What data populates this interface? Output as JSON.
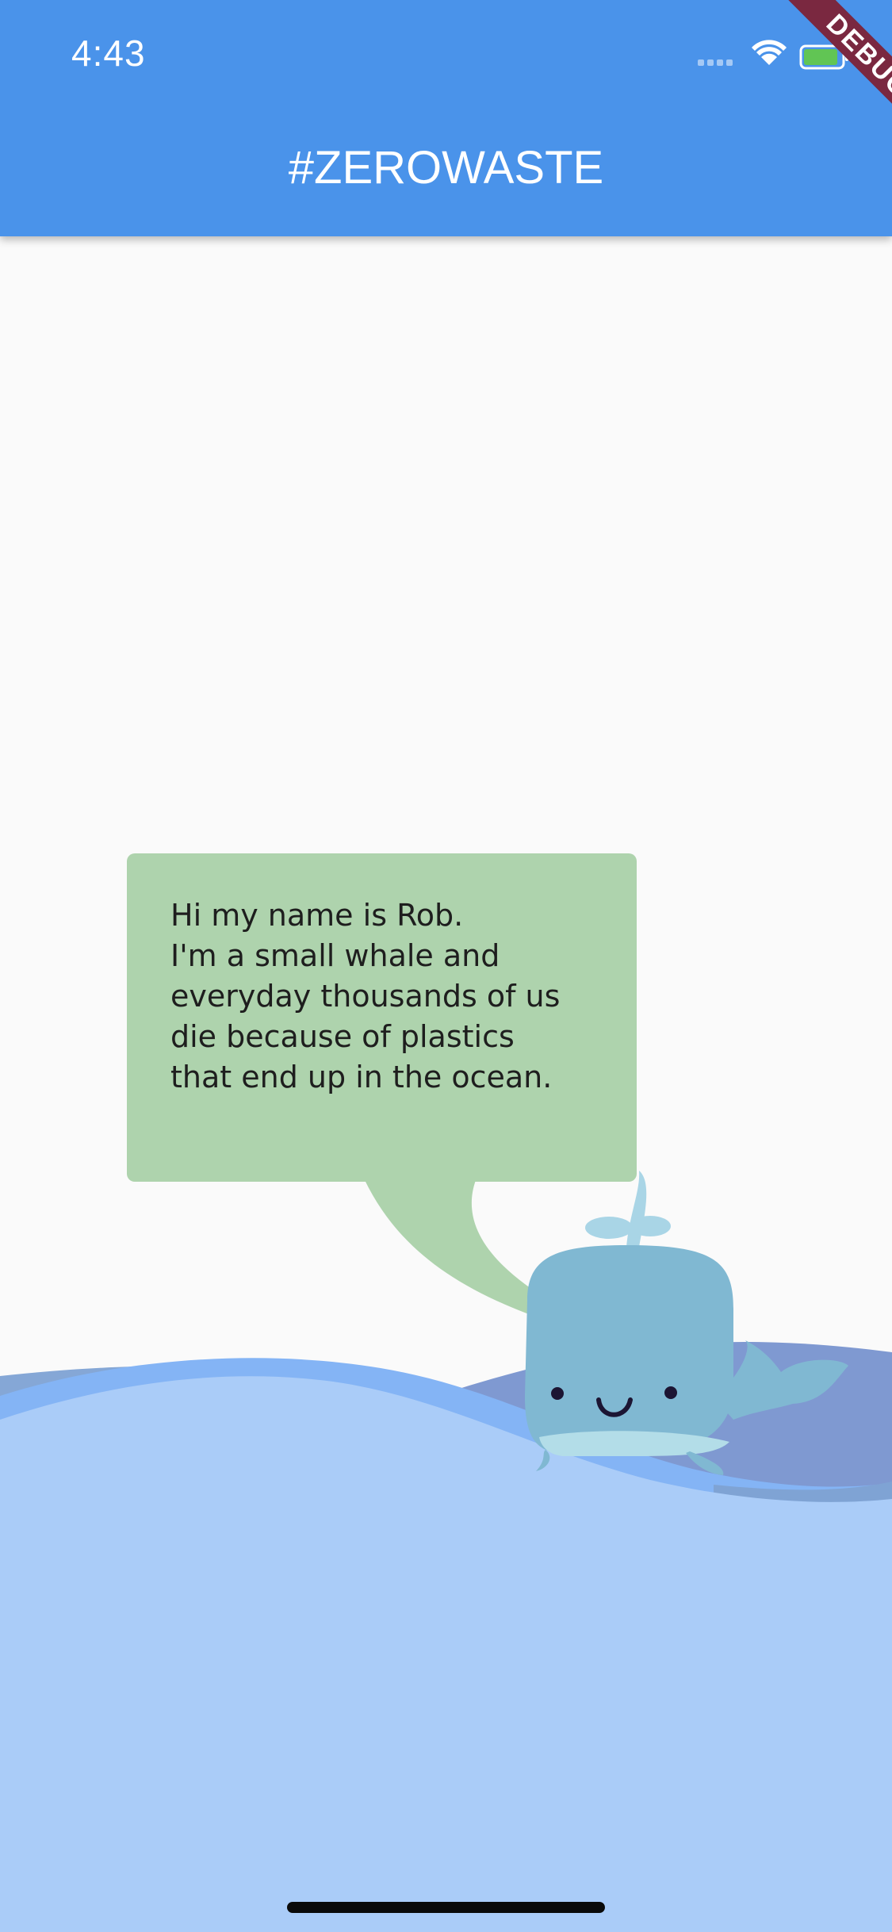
{
  "status_bar": {
    "time": "4:43",
    "icons": [
      "signal-icon",
      "wifi-icon",
      "battery-icon"
    ]
  },
  "app_bar": {
    "title": "#ZEROWASTE",
    "color": "#4A93EA"
  },
  "debug_banner": {
    "label": "DEBUG",
    "color": "#7A2840"
  },
  "speech_bubble": {
    "text": "Hi my name is Rob.\nI'm a small whale and\neveryday thousands of us\ndie because of plastics\nthat end up in the ocean.",
    "color": "#AED3AD"
  },
  "illustration": {
    "icon": "whale-icon",
    "water_color": "#AACCF8"
  }
}
